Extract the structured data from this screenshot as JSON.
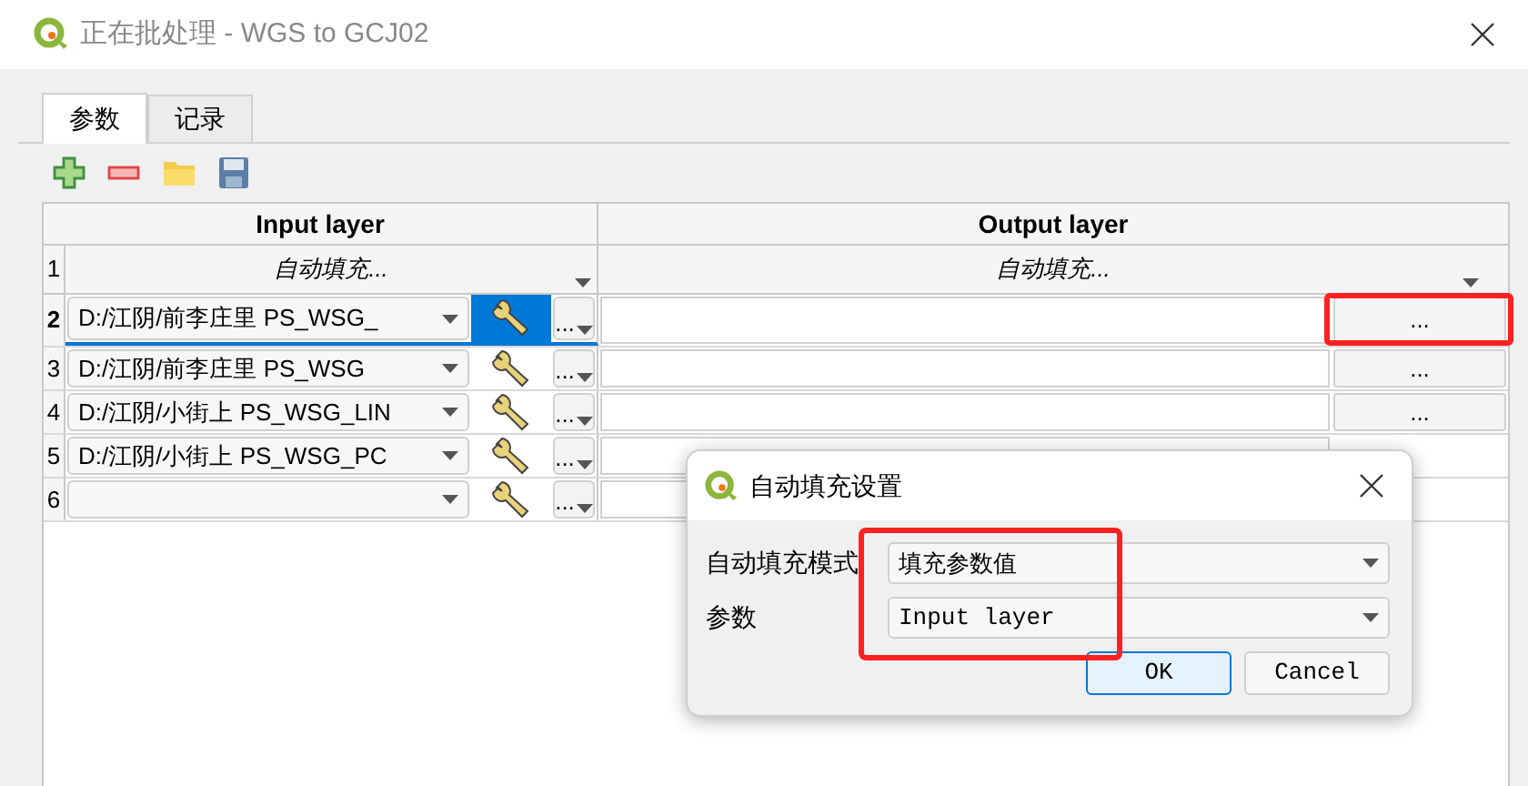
{
  "window": {
    "title": "正在批处理 - WGS to GCJ02"
  },
  "tabs": [
    {
      "label": "参数",
      "selected": true
    },
    {
      "label": "记录",
      "selected": false
    }
  ],
  "table": {
    "columns": [
      "Input layer",
      "Output layer"
    ],
    "autofill_row": {
      "number": "1",
      "input": "自动填充...",
      "output": "自动填充..."
    },
    "rows": [
      {
        "number": "2",
        "input": "D:/江阴/前李庄里 PS_WSG_",
        "input_button": "...",
        "output_button": "...",
        "selected": true
      },
      {
        "number": "3",
        "input": "D:/江阴/前李庄里 PS_WSG",
        "input_button": "...",
        "output_button": "...",
        "selected": false
      },
      {
        "number": "4",
        "input": "D:/江阴/小街上 PS_WSG_LIN",
        "input_button": "...",
        "output_button": "...",
        "selected": false
      },
      {
        "number": "5",
        "input": "D:/江阴/小街上 PS_WSG_PC",
        "input_button": "...",
        "selected": false
      },
      {
        "number": "6",
        "input": "",
        "input_button": "...",
        "selected": false
      }
    ]
  },
  "dialog": {
    "title": "自动填充设置",
    "fields": [
      {
        "label": "自动填充模式",
        "value": "填充参数值"
      },
      {
        "label": "参数",
        "value": "Input layer"
      }
    ],
    "buttons": [
      "OK",
      "Cancel"
    ]
  }
}
